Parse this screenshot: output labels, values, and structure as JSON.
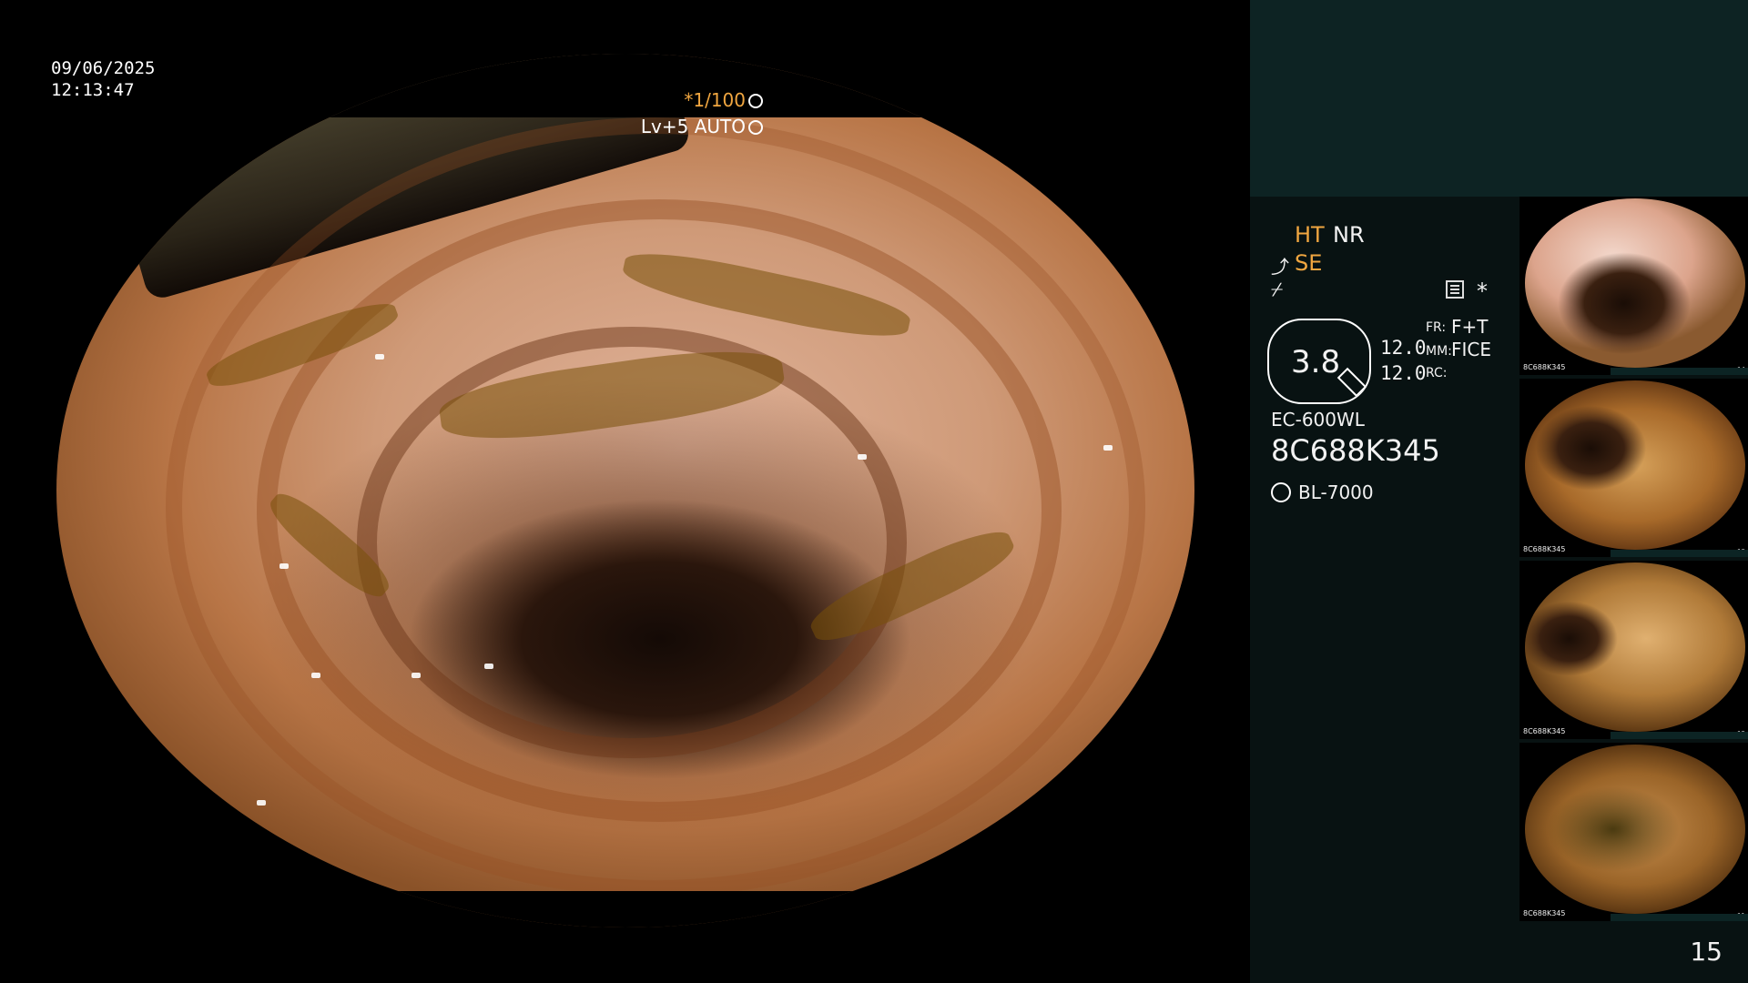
{
  "overlay": {
    "date": "09/06/2025",
    "time": "12:13:47",
    "shutter": "*1/100",
    "level": "Lv+5 AUTO"
  },
  "panel": {
    "ht": "HT",
    "nr": "NR",
    "se": "SE",
    "star": "*",
    "zoom_value": "3.8",
    "value1": "12.0",
    "value2": "12.0",
    "fr_label": "FR:",
    "fr_value": "F+T",
    "mm_label": "MM:",
    "mm_value": "FICE",
    "rc_label": "RC:",
    "scope_model": "EC-600WL",
    "scope_serial": "8C688K345",
    "light_model": "BL-7000",
    "page_number": "15"
  },
  "colors": {
    "accent_orange": "#f0a640",
    "panel_bg": "#081212",
    "panel_header_bg": "#0d2323"
  },
  "thumbnails": [
    {
      "number": "14",
      "serial": "8C688K345"
    },
    {
      "number": "13",
      "serial": "8C688K345"
    },
    {
      "number": "12",
      "serial": "8C688K345"
    },
    {
      "number": "11",
      "serial": "8C688K345"
    }
  ]
}
